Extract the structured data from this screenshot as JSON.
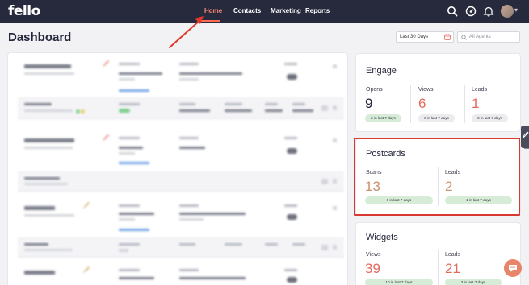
{
  "app": {
    "logo_text": "fello",
    "accent_color": "#ff6b55"
  },
  "nav": {
    "items": [
      {
        "label": "Home",
        "active": true
      },
      {
        "label": "Contacts",
        "active": false
      },
      {
        "label": "Marketing",
        "active": false
      },
      {
        "label": "Reports",
        "active": false
      }
    ],
    "icons": [
      "search-icon",
      "gauge-icon",
      "bell-icon",
      "avatar"
    ]
  },
  "page": {
    "title": "Dashboard"
  },
  "filters": {
    "date_range": "Last 30 Days",
    "agents_placeholder": "All Agents"
  },
  "engage": {
    "title": "Engage",
    "metrics": [
      {
        "label": "Opens",
        "value": "9",
        "chip": "2 in last 7 days",
        "chip_style": "green"
      },
      {
        "label": "Views",
        "value": "6",
        "chip": "0 in last 7 days",
        "chip_style": "grey"
      },
      {
        "label": "Leads",
        "value": "1",
        "chip": "0 in last 7 days",
        "chip_style": "grey"
      }
    ]
  },
  "postcards": {
    "title": "Postcards",
    "highlighted": true,
    "metrics": [
      {
        "label": "Scans",
        "value": "13",
        "chip": "6 in last 7 days",
        "chip_style": "green"
      },
      {
        "label": "Leads",
        "value": "2",
        "chip": "1 in last 7 days",
        "chip_style": "green"
      }
    ]
  },
  "widgets": {
    "title": "Widgets",
    "metrics": [
      {
        "label": "Views",
        "value": "39",
        "chip": "10 in last 7 days",
        "chip_style": "green"
      },
      {
        "label": "Leads",
        "value": "21",
        "chip": "3 in last 7 days",
        "chip_style": "green"
      }
    ]
  }
}
